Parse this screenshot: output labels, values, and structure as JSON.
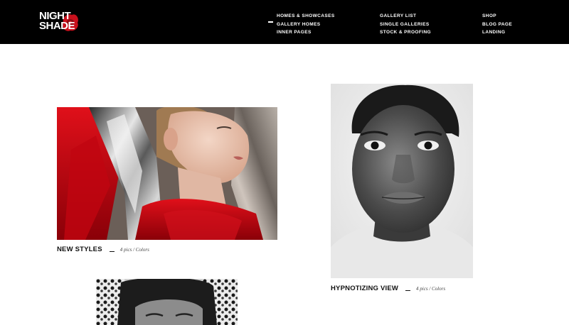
{
  "brand": {
    "line1": "NIGHT",
    "line2": "SHADE",
    "accent_color": "#d0101e",
    "icon": "red-flower-logo"
  },
  "nav": {
    "columns": [
      {
        "items": [
          "HOMES & SHOWCASES",
          "GALLERY HOMES",
          "INNER PAGES"
        ]
      },
      {
        "items": [
          "GALLERY LIST",
          "SINGLE GALLERIES",
          "STOCK & PROOFING"
        ]
      },
      {
        "items": [
          "SHOP",
          "BLOG PAGE",
          "LANDING"
        ]
      }
    ],
    "active_item": "GALLERY HOMES"
  },
  "galleries": [
    {
      "title": "NEW STYLES",
      "meta": "4 pics / Colors",
      "photo": "woman-in-red-and-silver-foil-photo"
    },
    {
      "title": "HYPNOTIZING VIEW",
      "meta": "4 pics / Colors",
      "photo": "black-and-white-portrait-photo"
    },
    {
      "title": "",
      "meta": "",
      "photo": "black-and-white-patterned-headwrap-photo"
    }
  ],
  "colors": {
    "header_bg": "#000000",
    "page_bg": "#ffffff",
    "text": "#111111"
  }
}
